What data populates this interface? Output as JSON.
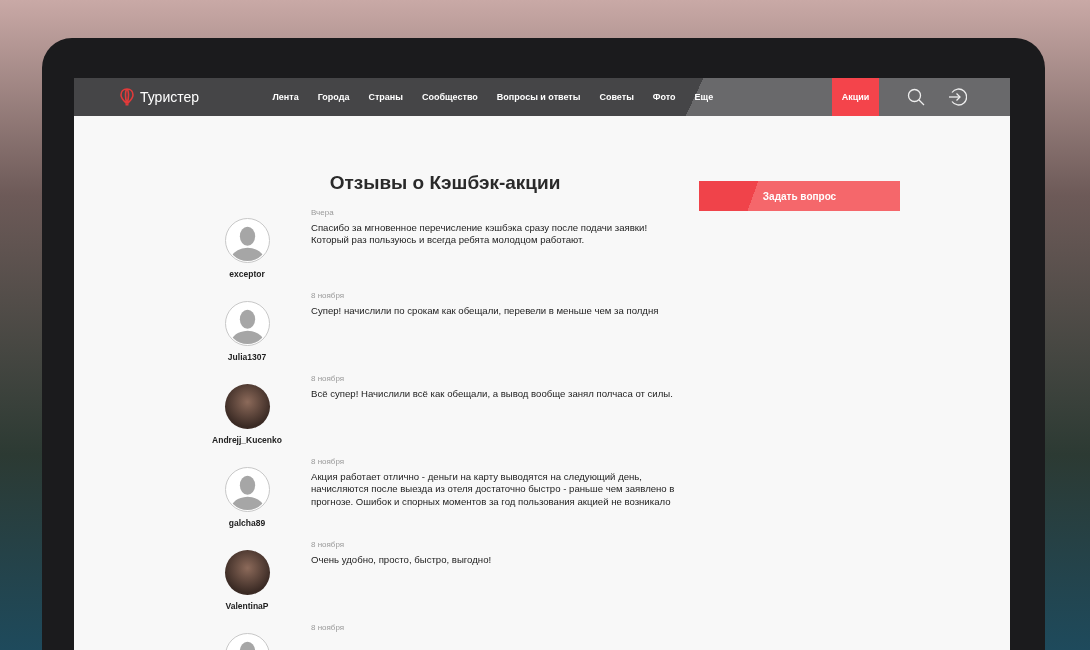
{
  "header": {
    "logo": "Туристер",
    "nav": [
      {
        "label": "Лента",
        "selected": false
      },
      {
        "label": "Города",
        "selected": false
      },
      {
        "label": "Страны",
        "selected": false
      },
      {
        "label": "Сообщество",
        "selected": false
      },
      {
        "label": "Вопросы и ответы",
        "selected": false
      },
      {
        "label": "Советы",
        "selected": false
      },
      {
        "label": "Фото",
        "selected": false
      },
      {
        "label": "Еще",
        "selected": false
      },
      {
        "label": "Акции",
        "selected": true
      }
    ]
  },
  "page": {
    "title": "Отзывы о Кэшбэк-акции",
    "ask_button": "Задать вопрос"
  },
  "reviews": [
    {
      "kind": "default",
      "user": "exceptor",
      "date": "Вчера",
      "text": "Спасибо за мгновенное перечисление кэшбэка сразу после подачи заявки! Который раз пользуюсь и всегда ребята молодцом работают."
    },
    {
      "kind": "default",
      "user": "Julia1307",
      "date": "8 ноября",
      "text": "Супер! начислили по срокам как обещали, перевели в меньше чем за полдня"
    },
    {
      "kind": "photo",
      "user": "Andrejj_Kucenko",
      "date": "8 ноября",
      "text": "Всё супер! Начислили всё как обещали, а вывод вообще занял полчаса от силы."
    },
    {
      "kind": "default",
      "user": "galcha89",
      "date": "8 ноября",
      "text": "Акция работает отлично - деньги на карту выводятся на следующий день, начисляются после выезда из отеля достаточно быстро - раньше чем заявлено в прогнозе. Ошибок и спорных моментов за год пользования акцией не возникало"
    },
    {
      "kind": "photo",
      "user": "ValentinaP",
      "date": "8 ноября",
      "text": "Очень удобно, просто, быстро, выгодно!"
    },
    {
      "kind": "default",
      "date": "8 ноября"
    }
  ]
}
